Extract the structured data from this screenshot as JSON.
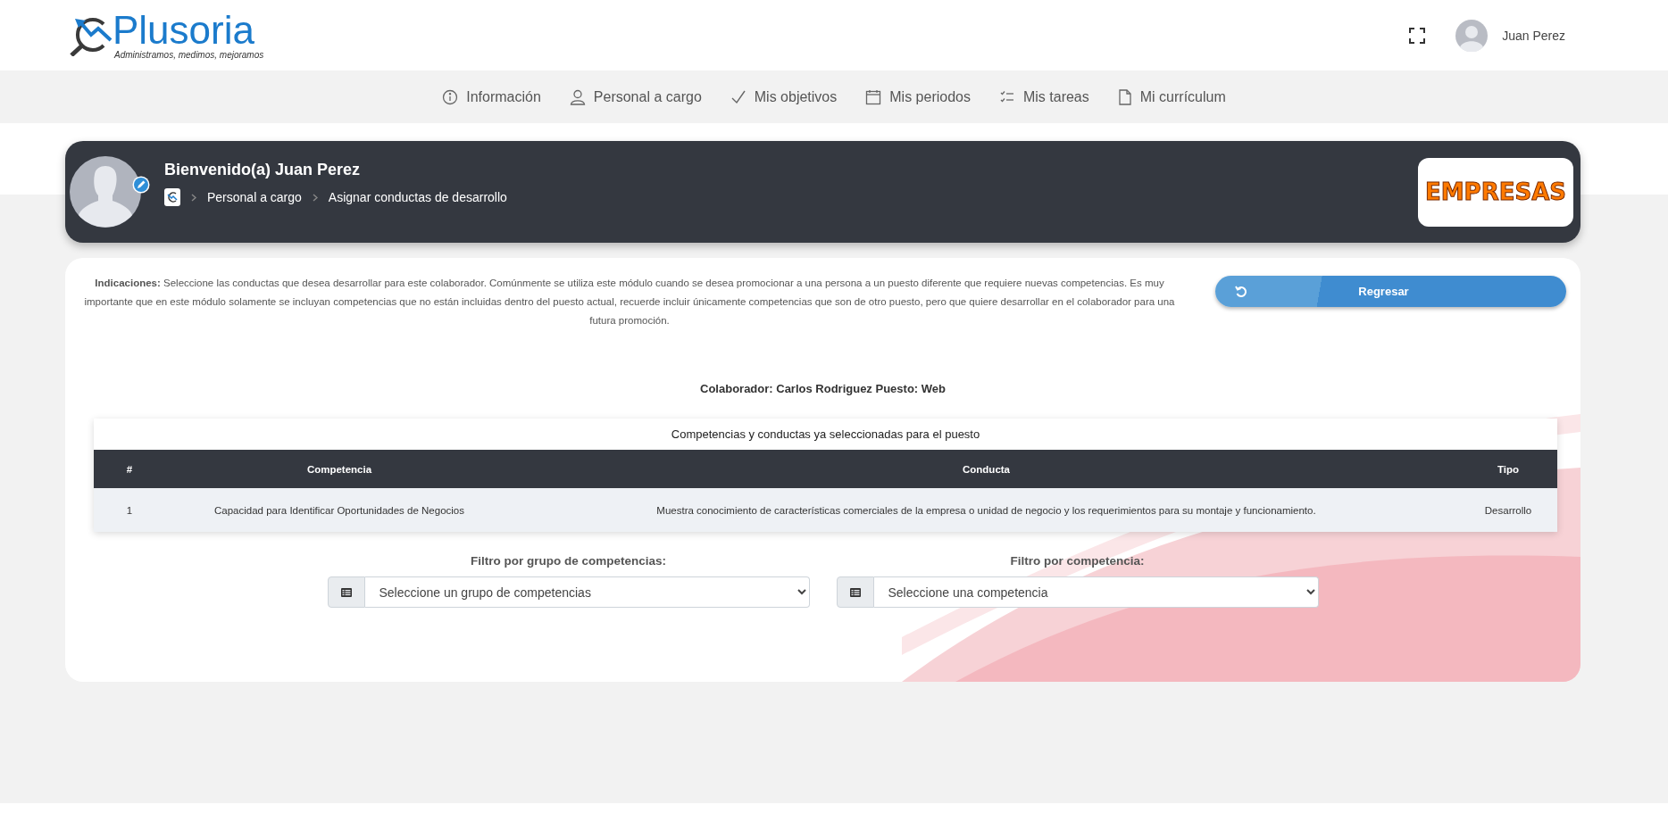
{
  "header": {
    "logo": {
      "name": "Plusoria",
      "tagline": "Administramos, medimos, mejoramos"
    },
    "user": {
      "name": "Juan Perez"
    }
  },
  "nav": [
    {
      "kind": "info",
      "label": "Información"
    },
    {
      "kind": "person",
      "label": "Personal a cargo"
    },
    {
      "kind": "check",
      "label": "Mis objetivos"
    },
    {
      "kind": "calendar",
      "label": "Mis periodos"
    },
    {
      "kind": "tasks",
      "label": "Mis tareas"
    },
    {
      "kind": "document",
      "label": "Mi currículum"
    }
  ],
  "banner": {
    "title": "Bienvenido(a) Juan Perez",
    "breadcrumb": [
      "Personal a cargo",
      "Asignar conductas de desarrollo"
    ],
    "company_logo": "EMPRESAS"
  },
  "indications": {
    "text": "**Indicaciones:** Seleccione las conductas que desea desarrollar para este colaborador. Comúnmente se utiliza este módulo cuando se desea promocionar a una persona a un puesto diferente que requiere nuevas competencias. Es muy importante que en este módulo solamente se incluyan competencias que no están incluidas dentro del puesto actual, recuerde incluir únicamente competencias que son de otro puesto, pero que quiere desarrollar en el colaborador para una futura promoción.",
    "button": "Regresar"
  },
  "collaborator": "Colaborador: Carlos Rodriguez Puesto: Web",
  "table": {
    "title": "Competencias y conductas ya seleccionadas para el puesto",
    "columns": [
      "#",
      "Competencia",
      "Conducta",
      "Tipo"
    ],
    "rows": [
      [
        "1",
        "Capacidad para Identificar Oportunidades de Negocios",
        "Muestra conocimiento de características comerciales de la empresa o unidad de negocio y los requerimientos para su montaje y funcionamiento.",
        "Desarrollo"
      ]
    ]
  },
  "filters": [
    {
      "label": "Filtro por grupo de competencias:",
      "placeholder": "Seleccione un grupo de competencias"
    },
    {
      "label": "Filtro por competencia:",
      "placeholder": "Seleccione una competencia"
    }
  ]
}
